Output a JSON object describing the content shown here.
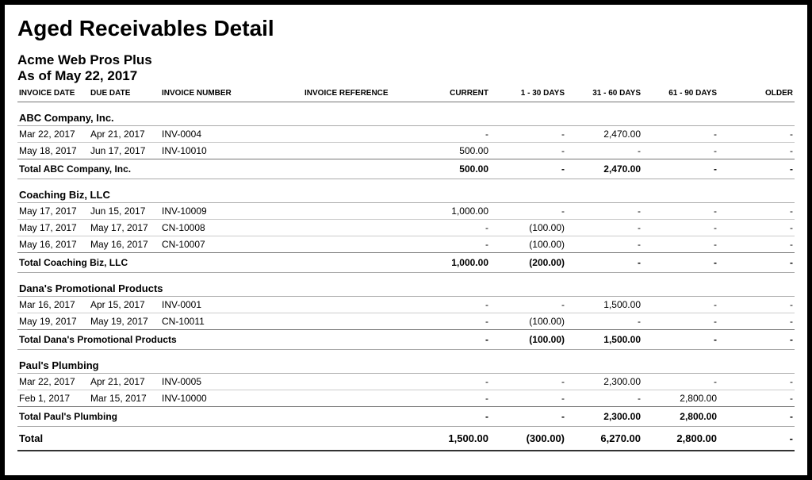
{
  "title": "Aged Receivables Detail",
  "company": "Acme Web Pros Plus",
  "asof": "As of May 22, 2017",
  "columns": {
    "invoice_date": "INVOICE DATE",
    "due_date": "DUE DATE",
    "invoice_number": "INVOICE NUMBER",
    "invoice_reference": "INVOICE REFERENCE",
    "current": "CURRENT",
    "d1_30": "1 - 30 DAYS",
    "d31_60": "31 - 60 DAYS",
    "d61_90": "61 - 90 DAYS",
    "older": "OLDER"
  },
  "groups": [
    {
      "name": "ABC Company, Inc.",
      "rows": [
        {
          "invoice_date": "Mar 22, 2017",
          "due_date": "Apr 21, 2017",
          "invoice_number": "INV-0004",
          "invoice_reference": "",
          "current": "-",
          "d1_30": "-",
          "d31_60": "2,470.00",
          "d61_90": "-",
          "older": "-"
        },
        {
          "invoice_date": "May 18, 2017",
          "due_date": "Jun 17, 2017",
          "invoice_number": "INV-10010",
          "invoice_reference": "",
          "current": "500.00",
          "d1_30": "-",
          "d31_60": "-",
          "d61_90": "-",
          "older": "-"
        }
      ],
      "total": {
        "label": "Total ABC Company, Inc.",
        "current": "500.00",
        "d1_30": "-",
        "d31_60": "2,470.00",
        "d61_90": "-",
        "older": "-"
      }
    },
    {
      "name": "Coaching Biz, LLC",
      "rows": [
        {
          "invoice_date": "May 17, 2017",
          "due_date": "Jun 15, 2017",
          "invoice_number": "INV-10009",
          "invoice_reference": "",
          "current": "1,000.00",
          "d1_30": "-",
          "d31_60": "-",
          "d61_90": "-",
          "older": "-"
        },
        {
          "invoice_date": "May 17, 2017",
          "due_date": "May 17, 2017",
          "invoice_number": "CN-10008",
          "invoice_reference": "",
          "current": "-",
          "d1_30": "(100.00)",
          "d31_60": "-",
          "d61_90": "-",
          "older": "-"
        },
        {
          "invoice_date": "May 16, 2017",
          "due_date": "May 16, 2017",
          "invoice_number": "CN-10007",
          "invoice_reference": "",
          "current": "-",
          "d1_30": "(100.00)",
          "d31_60": "-",
          "d61_90": "-",
          "older": "-"
        }
      ],
      "total": {
        "label": "Total Coaching Biz, LLC",
        "current": "1,000.00",
        "d1_30": "(200.00)",
        "d31_60": "-",
        "d61_90": "-",
        "older": "-"
      }
    },
    {
      "name": "Dana's Promotional Products",
      "rows": [
        {
          "invoice_date": "Mar 16, 2017",
          "due_date": "Apr 15, 2017",
          "invoice_number": "INV-0001",
          "invoice_reference": "",
          "current": "-",
          "d1_30": "-",
          "d31_60": "1,500.00",
          "d61_90": "-",
          "older": "-"
        },
        {
          "invoice_date": "May 19, 2017",
          "due_date": "May 19, 2017",
          "invoice_number": "CN-10011",
          "invoice_reference": "",
          "current": "-",
          "d1_30": "(100.00)",
          "d31_60": "-",
          "d61_90": "-",
          "older": "-"
        }
      ],
      "total": {
        "label": "Total Dana's Promotional Products",
        "current": "-",
        "d1_30": "(100.00)",
        "d31_60": "1,500.00",
        "d61_90": "-",
        "older": "-"
      }
    },
    {
      "name": "Paul's Plumbing",
      "rows": [
        {
          "invoice_date": "Mar 22, 2017",
          "due_date": "Apr 21, 2017",
          "invoice_number": "INV-0005",
          "invoice_reference": "",
          "current": "-",
          "d1_30": "-",
          "d31_60": "2,300.00",
          "d61_90": "-",
          "older": "-"
        },
        {
          "invoice_date": "Feb 1, 2017",
          "due_date": "Mar 15, 2017",
          "invoice_number": "INV-10000",
          "invoice_reference": "",
          "current": "-",
          "d1_30": "-",
          "d31_60": "-",
          "d61_90": "2,800.00",
          "older": "-"
        }
      ],
      "total": {
        "label": "Total Paul's Plumbing",
        "current": "-",
        "d1_30": "-",
        "d31_60": "2,300.00",
        "d61_90": "2,800.00",
        "older": "-"
      }
    }
  ],
  "grand_total": {
    "label": "Total",
    "current": "1,500.00",
    "d1_30": "(300.00)",
    "d31_60": "6,270.00",
    "d61_90": "2,800.00",
    "older": "-"
  }
}
